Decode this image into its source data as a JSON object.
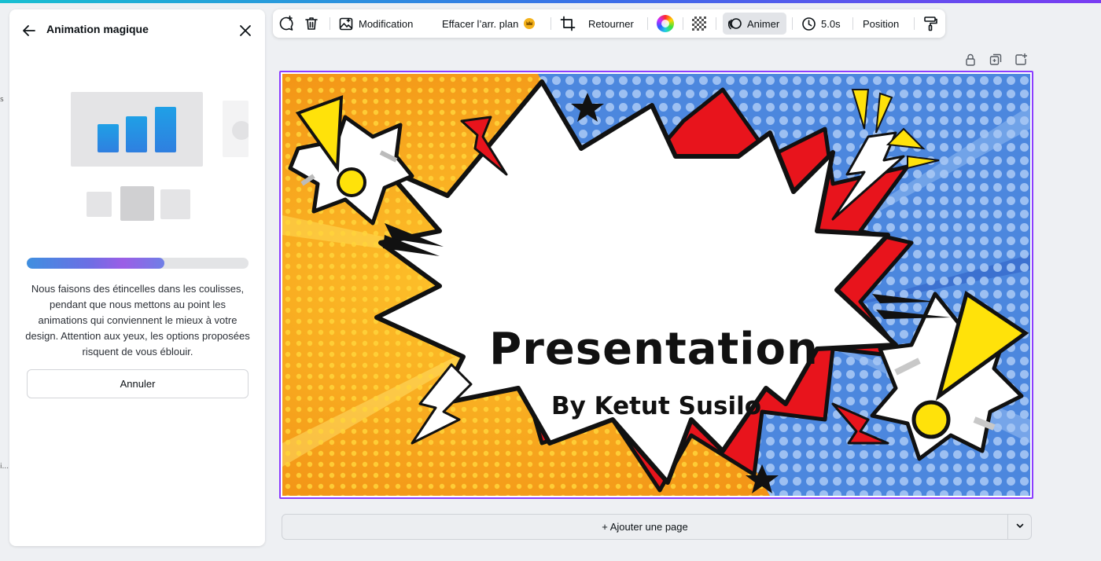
{
  "panel": {
    "title": "Animation magique",
    "progress": 0.62,
    "description": "Nous faisons des étincelles dans les coulisses, pendant que nous mettons au point les animations qui conviennent le mieux à votre design. Attention aux yeux, les options proposées risquent de vous éblouir.",
    "cancel_label": "Annuler"
  },
  "left_edge": {
    "fragment_1": "s",
    "fragment_2": "i..."
  },
  "toolbar": {
    "items": [
      {
        "label": "",
        "icon": "comment-plus-icon"
      },
      {
        "label": "",
        "icon": "trash-icon"
      },
      {
        "label": "Modification",
        "icon": "edit-image-icon"
      },
      {
        "label": "Effacer l’arr. plan",
        "icon": "crown-icon"
      },
      {
        "label": "",
        "icon": "crop-icon"
      },
      {
        "label": "Retourner",
        "icon": ""
      },
      {
        "label": "",
        "icon": "color-wheel-icon"
      },
      {
        "label": "",
        "icon": "transparency-icon"
      },
      {
        "label": "Animer",
        "icon": "animate-icon",
        "active": true
      },
      {
        "label": "5.0s",
        "icon": "clock-icon"
      },
      {
        "label": "Position",
        "icon": ""
      },
      {
        "label": "",
        "icon": "paint-roller-icon"
      }
    ]
  },
  "canvas_actions": [
    "lock-icon",
    "duplicate-icon",
    "add-page-icon"
  ],
  "slide": {
    "title": "Presentation",
    "subtitle": "By Ketut Susilo"
  },
  "add_page": {
    "label": "+ Ajouter une page"
  },
  "colors": {
    "accent": "#8b3dff",
    "slide_orange": "#f5a416",
    "slide_blue": "#4a86dd",
    "burst_red": "#e8141c",
    "star_yellow": "#ffe20a"
  }
}
